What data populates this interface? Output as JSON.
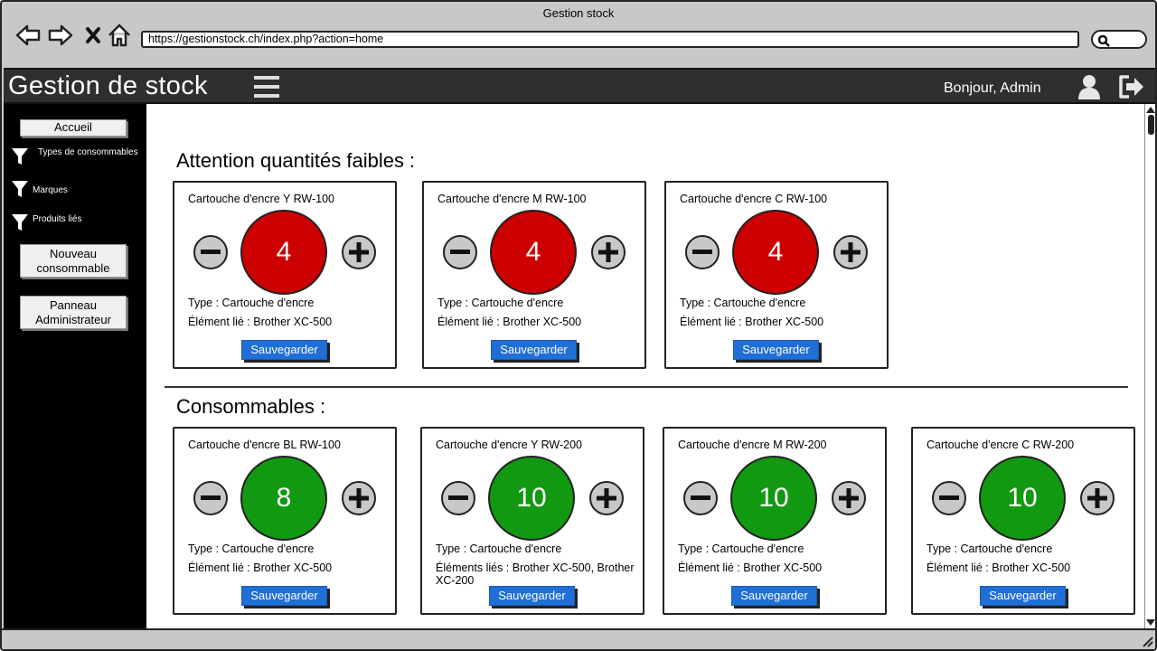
{
  "window": {
    "title": "Gestion stock"
  },
  "browser": {
    "url": "https://gestionstock.ch/index.php?action=home"
  },
  "header": {
    "title": "Gestion de stock",
    "greeting": "Bonjour, Admin"
  },
  "sidebar": {
    "home": "Accueil",
    "filters": [
      "Types de consommables",
      "Marques",
      "Produits liés"
    ],
    "new_consumable": "Nouveau consommable",
    "admin_panel": "Panneau Administrateur"
  },
  "colors": {
    "low": "#cc0000",
    "ok": "#119911",
    "accent": "#1f6fd6"
  },
  "low_stock": {
    "title": "Attention quantités faibles :",
    "cards": [
      {
        "name": "Cartouche d'encre Y RW-100",
        "qty": "4",
        "type": "Type : Cartouche d'encre",
        "linked": "Élément lié : Brother XC-500",
        "save": "Sauvegarder"
      },
      {
        "name": "Cartouche d'encre M RW-100",
        "qty": "4",
        "type": "Type : Cartouche d'encre",
        "linked": "Élément lié : Brother XC-500",
        "save": "Sauvegarder"
      },
      {
        "name": "Cartouche d'encre C RW-100",
        "qty": "4",
        "type": "Type : Cartouche d'encre",
        "linked": "Élément lié : Brother XC-500",
        "save": "Sauvegarder"
      }
    ]
  },
  "consumables": {
    "title": "Consommables :",
    "cards": [
      {
        "name": "Cartouche d'encre BL RW-100",
        "qty": "8",
        "type": "Type : Cartouche d'encre",
        "linked": "Élément lié : Brother XC-500",
        "save": "Sauvegarder"
      },
      {
        "name": "Cartouche d'encre Y RW-200",
        "qty": "10",
        "type": "Type : Cartouche d'encre",
        "linked": "Éléments liés : Brother XC-500, Brother XC-200",
        "save": "Sauvegarder"
      },
      {
        "name": "Cartouche d'encre M RW-200",
        "qty": "10",
        "type": "Type : Cartouche d'encre",
        "linked": "Élément lié : Brother XC-500",
        "save": "Sauvegarder"
      },
      {
        "name": "Cartouche d'encre C RW-200",
        "qty": "10",
        "type": "Type : Cartouche d'encre",
        "linked": "Élément lié : Brother XC-500",
        "save": "Sauvegarder"
      }
    ]
  },
  "icons": [
    "back-arrow-icon",
    "forward-arrow-icon",
    "close-icon",
    "home-icon",
    "search-icon",
    "hamburger-menu-icon",
    "user-icon",
    "logout-icon",
    "filter-icon",
    "minus-icon",
    "plus-icon"
  ]
}
